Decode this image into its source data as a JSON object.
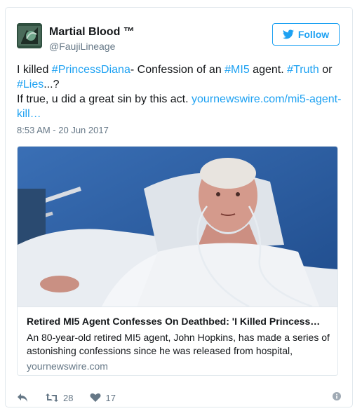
{
  "author": {
    "name": "Martial Blood ™",
    "handle": "@FaujiLineage"
  },
  "follow_button": {
    "label": "Follow",
    "icon": "twitter-bird-icon"
  },
  "tweet": {
    "line1_pre": "I killed ",
    "hashtag1": "#PrincessDiana",
    "line1_mid": "- Confession of an ",
    "hashtag2": "#MI5",
    "line1_mid2": " agent. ",
    "hashtag3": "#Truth",
    "line1_or": " or",
    "hashtag4": "#Lies",
    "line2_post": "...?",
    "line3_pre": "If true, u did a great sin by this act. ",
    "link": "yournewswire.com/mi5-agent-kill…",
    "timestamp": "8:53 AM - 20 Jun 2017"
  },
  "card": {
    "image_alt": "elderly man in hospital bed",
    "title": "Retired MI5 Agent Confesses On Deathbed: 'I Killed Princess…",
    "description": "An 80-year-old retired MI5 agent, John Hopkins, has made a series of astonishing confessions since he was released from hospital,",
    "domain": "yournewswire.com"
  },
  "actions": {
    "reply_icon": "reply-icon",
    "retweet_icon": "retweet-icon",
    "retweet_count": "28",
    "like_icon": "heart-icon",
    "like_count": "17",
    "info_icon": "info-icon"
  },
  "colors": {
    "link": "#1da1f2",
    "muted": "#657786",
    "text": "#14171a",
    "border": "#e1e8ed"
  }
}
